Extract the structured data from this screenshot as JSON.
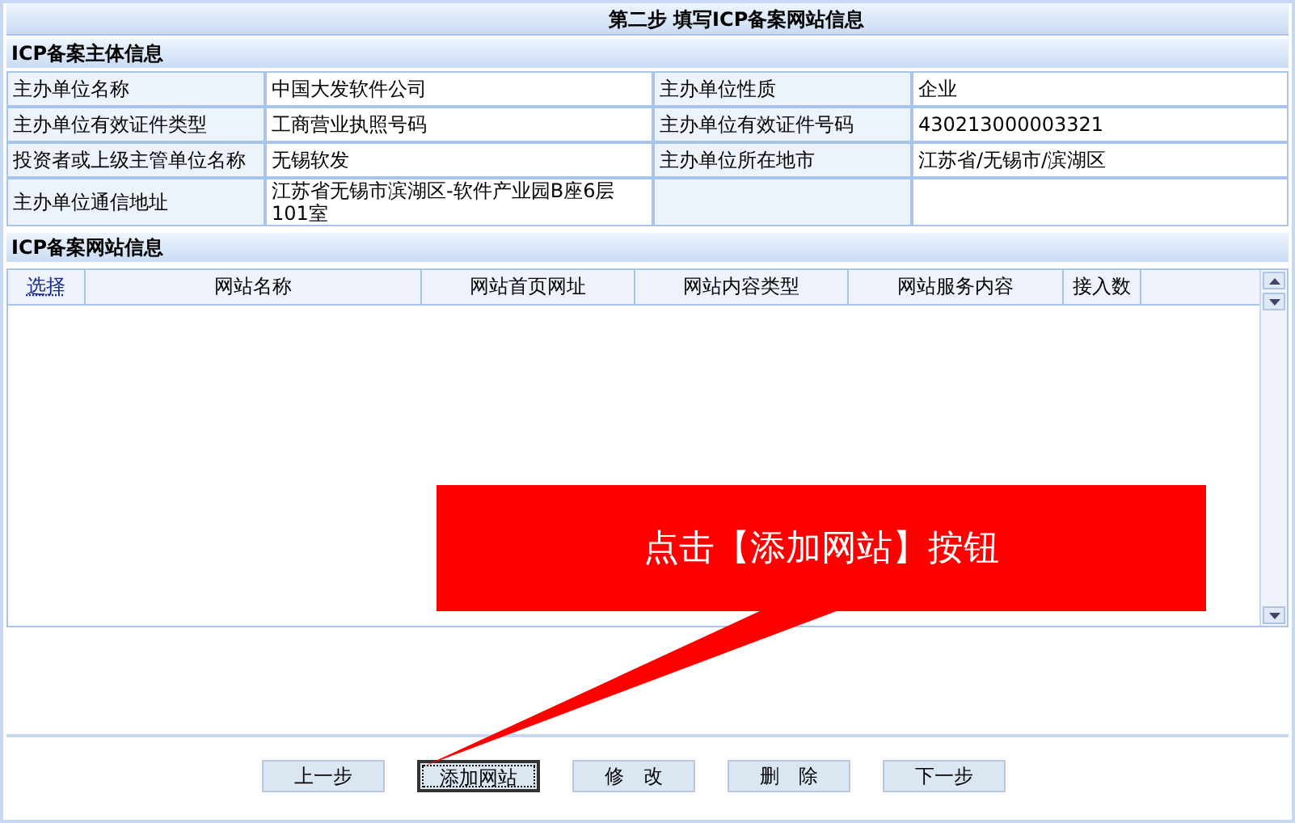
{
  "title": "第二步  填写ICP备案网站信息",
  "subject_section": {
    "heading": "ICP备案主体信息",
    "fields": [
      {
        "label": "主办单位名称",
        "value": "中国大发软件公司"
      },
      {
        "label": "主办单位性质",
        "value": "企业"
      },
      {
        "label": "主办单位有效证件类型",
        "value": "工商营业执照号码"
      },
      {
        "label": "主办单位有效证件号码",
        "value": "430213000003321"
      },
      {
        "label": "投资者或上级主管单位名称",
        "value": "无锡软发"
      },
      {
        "label": "主办单位所在地市",
        "value": "江苏省/无锡市/滨湖区"
      },
      {
        "label": "主办单位通信地址",
        "value": "江苏省无锡市滨湖区-软件产业园B座6层101室"
      }
    ]
  },
  "site_section": {
    "heading": "ICP备案网站信息",
    "columns": [
      {
        "label": "选择",
        "kind": "link"
      },
      {
        "label": "网站名称",
        "kind": "text"
      },
      {
        "label": "网站首页网址",
        "kind": "text"
      },
      {
        "label": "网站内容类型",
        "kind": "text"
      },
      {
        "label": "网站服务内容",
        "kind": "text"
      },
      {
        "label": "接入数",
        "kind": "text"
      }
    ]
  },
  "buttons": [
    {
      "label": "上一步",
      "focused": false
    },
    {
      "label": "添加网站",
      "focused": true
    },
    {
      "label": "修　改",
      "focused": false
    },
    {
      "label": "删　除",
      "focused": false
    },
    {
      "label": "下一步",
      "focused": false
    }
  ],
  "callout": {
    "text": "点击【添加网站】按钮"
  }
}
